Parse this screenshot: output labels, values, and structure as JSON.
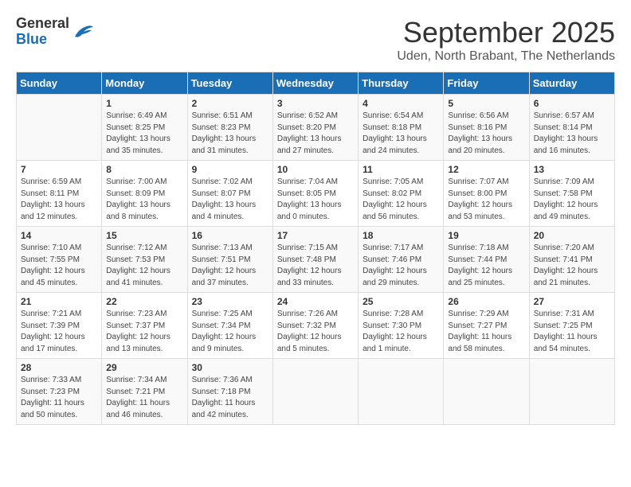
{
  "logo": {
    "general": "General",
    "blue": "Blue"
  },
  "title": "September 2025",
  "location": "Uden, North Brabant, The Netherlands",
  "days_of_week": [
    "Sunday",
    "Monday",
    "Tuesday",
    "Wednesday",
    "Thursday",
    "Friday",
    "Saturday"
  ],
  "weeks": [
    [
      {
        "day": "",
        "info": ""
      },
      {
        "day": "1",
        "info": "Sunrise: 6:49 AM\nSunset: 8:25 PM\nDaylight: 13 hours\nand 35 minutes."
      },
      {
        "day": "2",
        "info": "Sunrise: 6:51 AM\nSunset: 8:23 PM\nDaylight: 13 hours\nand 31 minutes."
      },
      {
        "day": "3",
        "info": "Sunrise: 6:52 AM\nSunset: 8:20 PM\nDaylight: 13 hours\nand 27 minutes."
      },
      {
        "day": "4",
        "info": "Sunrise: 6:54 AM\nSunset: 8:18 PM\nDaylight: 13 hours\nand 24 minutes."
      },
      {
        "day": "5",
        "info": "Sunrise: 6:56 AM\nSunset: 8:16 PM\nDaylight: 13 hours\nand 20 minutes."
      },
      {
        "day": "6",
        "info": "Sunrise: 6:57 AM\nSunset: 8:14 PM\nDaylight: 13 hours\nand 16 minutes."
      }
    ],
    [
      {
        "day": "7",
        "info": "Sunrise: 6:59 AM\nSunset: 8:11 PM\nDaylight: 13 hours\nand 12 minutes."
      },
      {
        "day": "8",
        "info": "Sunrise: 7:00 AM\nSunset: 8:09 PM\nDaylight: 13 hours\nand 8 minutes."
      },
      {
        "day": "9",
        "info": "Sunrise: 7:02 AM\nSunset: 8:07 PM\nDaylight: 13 hours\nand 4 minutes."
      },
      {
        "day": "10",
        "info": "Sunrise: 7:04 AM\nSunset: 8:05 PM\nDaylight: 13 hours\nand 0 minutes."
      },
      {
        "day": "11",
        "info": "Sunrise: 7:05 AM\nSunset: 8:02 PM\nDaylight: 12 hours\nand 56 minutes."
      },
      {
        "day": "12",
        "info": "Sunrise: 7:07 AM\nSunset: 8:00 PM\nDaylight: 12 hours\nand 53 minutes."
      },
      {
        "day": "13",
        "info": "Sunrise: 7:09 AM\nSunset: 7:58 PM\nDaylight: 12 hours\nand 49 minutes."
      }
    ],
    [
      {
        "day": "14",
        "info": "Sunrise: 7:10 AM\nSunset: 7:55 PM\nDaylight: 12 hours\nand 45 minutes."
      },
      {
        "day": "15",
        "info": "Sunrise: 7:12 AM\nSunset: 7:53 PM\nDaylight: 12 hours\nand 41 minutes."
      },
      {
        "day": "16",
        "info": "Sunrise: 7:13 AM\nSunset: 7:51 PM\nDaylight: 12 hours\nand 37 minutes."
      },
      {
        "day": "17",
        "info": "Sunrise: 7:15 AM\nSunset: 7:48 PM\nDaylight: 12 hours\nand 33 minutes."
      },
      {
        "day": "18",
        "info": "Sunrise: 7:17 AM\nSunset: 7:46 PM\nDaylight: 12 hours\nand 29 minutes."
      },
      {
        "day": "19",
        "info": "Sunrise: 7:18 AM\nSunset: 7:44 PM\nDaylight: 12 hours\nand 25 minutes."
      },
      {
        "day": "20",
        "info": "Sunrise: 7:20 AM\nSunset: 7:41 PM\nDaylight: 12 hours\nand 21 minutes."
      }
    ],
    [
      {
        "day": "21",
        "info": "Sunrise: 7:21 AM\nSunset: 7:39 PM\nDaylight: 12 hours\nand 17 minutes."
      },
      {
        "day": "22",
        "info": "Sunrise: 7:23 AM\nSunset: 7:37 PM\nDaylight: 12 hours\nand 13 minutes."
      },
      {
        "day": "23",
        "info": "Sunrise: 7:25 AM\nSunset: 7:34 PM\nDaylight: 12 hours\nand 9 minutes."
      },
      {
        "day": "24",
        "info": "Sunrise: 7:26 AM\nSunset: 7:32 PM\nDaylight: 12 hours\nand 5 minutes."
      },
      {
        "day": "25",
        "info": "Sunrise: 7:28 AM\nSunset: 7:30 PM\nDaylight: 12 hours\nand 1 minute."
      },
      {
        "day": "26",
        "info": "Sunrise: 7:29 AM\nSunset: 7:27 PM\nDaylight: 11 hours\nand 58 minutes."
      },
      {
        "day": "27",
        "info": "Sunrise: 7:31 AM\nSunset: 7:25 PM\nDaylight: 11 hours\nand 54 minutes."
      }
    ],
    [
      {
        "day": "28",
        "info": "Sunrise: 7:33 AM\nSunset: 7:23 PM\nDaylight: 11 hours\nand 50 minutes."
      },
      {
        "day": "29",
        "info": "Sunrise: 7:34 AM\nSunset: 7:21 PM\nDaylight: 11 hours\nand 46 minutes."
      },
      {
        "day": "30",
        "info": "Sunrise: 7:36 AM\nSunset: 7:18 PM\nDaylight: 11 hours\nand 42 minutes."
      },
      {
        "day": "",
        "info": ""
      },
      {
        "day": "",
        "info": ""
      },
      {
        "day": "",
        "info": ""
      },
      {
        "day": "",
        "info": ""
      }
    ]
  ]
}
